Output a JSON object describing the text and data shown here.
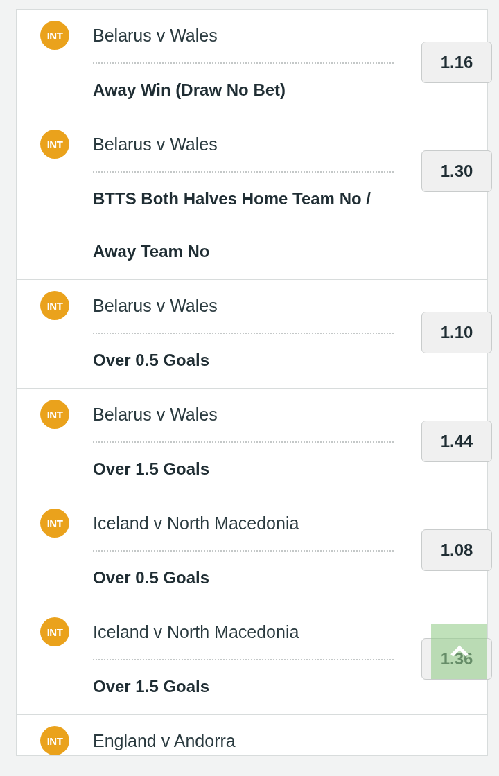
{
  "bets": [
    {
      "badge": "INT",
      "match": "Belarus v Wales",
      "market": "Away Win (Draw No Bet)",
      "odds": "1.16"
    },
    {
      "badge": "INT",
      "match": "Belarus v Wales",
      "market": "BTTS Both Halves Home Team No / Away Team No",
      "odds": "1.30"
    },
    {
      "badge": "INT",
      "match": "Belarus v Wales",
      "market": "Over 0.5 Goals",
      "odds": "1.10"
    },
    {
      "badge": "INT",
      "match": "Belarus v Wales",
      "market": "Over 1.5 Goals",
      "odds": "1.44"
    },
    {
      "badge": "INT",
      "match": "Iceland v North Macedonia",
      "market": "Over 0.5 Goals",
      "odds": "1.08"
    },
    {
      "badge": "INT",
      "match": "Iceland v North Macedonia",
      "market": "Over 1.5 Goals",
      "odds": "1.36"
    },
    {
      "badge": "INT",
      "match": "England v Andorra"
    }
  ]
}
